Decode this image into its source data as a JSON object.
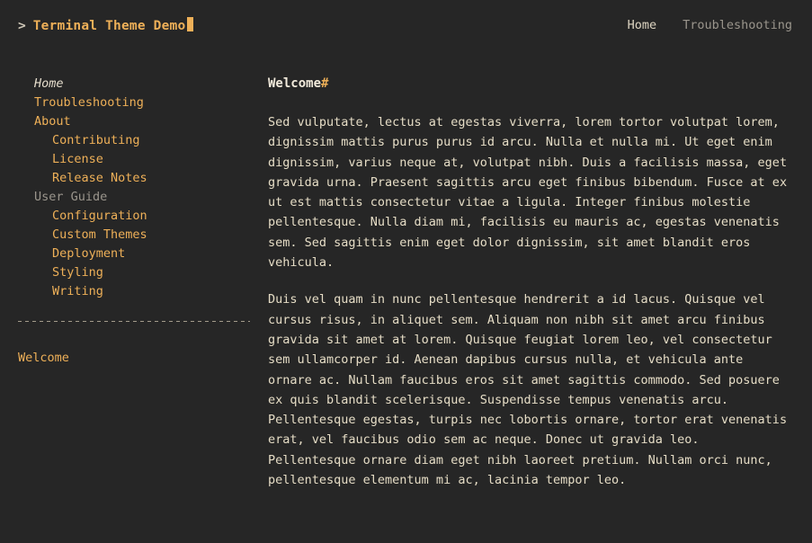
{
  "header": {
    "prompt_symbol": ">",
    "site_title": "Terminal Theme Demo",
    "nav": [
      {
        "label": "Home",
        "state": "current"
      },
      {
        "label": "Troubleshooting",
        "state": "plain"
      }
    ]
  },
  "sidebar": {
    "items": [
      {
        "label": "Home",
        "depth": 0,
        "kind": "active"
      },
      {
        "label": "Troubleshooting",
        "depth": 0,
        "kind": "link"
      },
      {
        "label": "About",
        "depth": 0,
        "kind": "link"
      },
      {
        "label": "Contributing",
        "depth": 1,
        "kind": "link"
      },
      {
        "label": "License",
        "depth": 1,
        "kind": "link"
      },
      {
        "label": "Release Notes",
        "depth": 1,
        "kind": "link"
      },
      {
        "label": "User Guide",
        "depth": 0,
        "kind": "section"
      },
      {
        "label": "Configuration",
        "depth": 1,
        "kind": "link"
      },
      {
        "label": "Custom Themes",
        "depth": 1,
        "kind": "link"
      },
      {
        "label": "Deployment",
        "depth": 1,
        "kind": "link"
      },
      {
        "label": "Styling",
        "depth": 1,
        "kind": "link"
      },
      {
        "label": "Writing",
        "depth": 1,
        "kind": "link"
      }
    ],
    "post_links": [
      {
        "label": "Welcome"
      }
    ]
  },
  "main": {
    "title": "Welcome",
    "anchor": "#",
    "paragraphs": [
      "Sed vulputate, lectus at egestas viverra, lorem tortor volutpat lorem, dignissim mattis purus purus id arcu. Nulla et nulla mi. Ut eget enim dignissim, varius neque at, volutpat nibh. Duis a facilisis massa, eget gravida urna. Praesent sagittis arcu eget finibus bibendum. Fusce at ex ut est mattis consectetur vitae a ligula. Integer finibus molestie pellentesque. Nulla diam mi, facilisis eu mauris ac, egestas venenatis sem. Sed sagittis enim eget dolor dignissim, sit amet blandit eros vehicula.",
      "Duis vel quam in nunc pellentesque hendrerit a id lacus. Quisque vel cursus risus, in aliquet sem. Aliquam non nibh sit amet arcu finibus gravida sit amet at lorem. Quisque feugiat lorem leo, vel consectetur sem ullamcorper id. Aenean dapibus cursus nulla, et vehicula ante ornare ac. Nullam faucibus eros sit amet sagittis commodo. Sed posuere ex quis blandit scelerisque. Suspendisse tempus venenatis arcu. Pellentesque egestas, turpis nec lobortis ornare, tortor erat venenatis erat, vel faucibus odio sem ac neque. Donec ut gravida leo. Pellentesque ornare diam eget nibh laoreet pretium. Nullam orci nunc, pellentesque elementum mi ac, lacinia tempor leo."
    ]
  },
  "colors": {
    "background": "#262626",
    "accent": "#eeb058",
    "body_text": "#e6ddc6",
    "muted": "#9a958c"
  }
}
